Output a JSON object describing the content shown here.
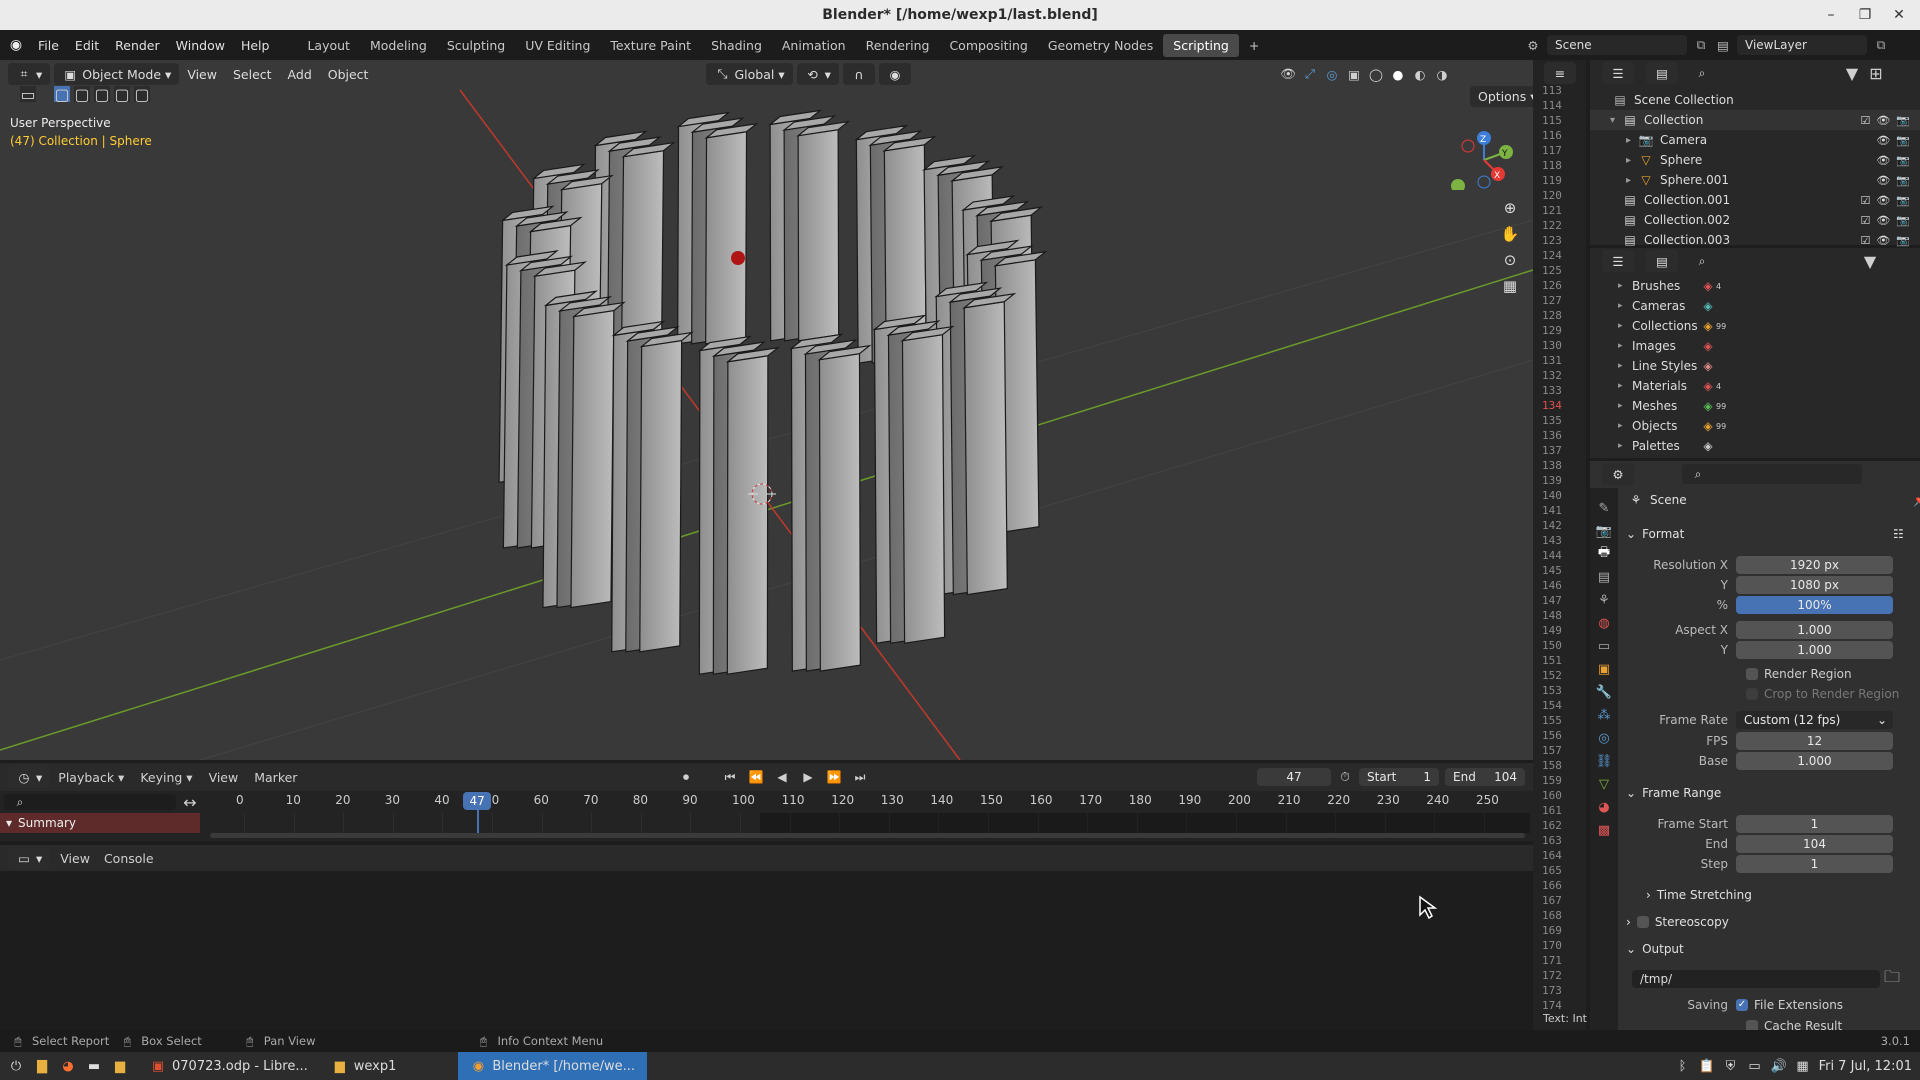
{
  "window": {
    "title": "Blender* [/home/wexp1/last.blend]"
  },
  "menu": [
    "File",
    "Edit",
    "Render",
    "Window",
    "Help"
  ],
  "workspaces": [
    "Layout",
    "Modeling",
    "Sculpting",
    "UV Editing",
    "Texture Paint",
    "Shading",
    "Animation",
    "Rendering",
    "Compositing",
    "Geometry Nodes",
    "Scripting"
  ],
  "active_workspace": "Scripting",
  "scene_field": "Scene",
  "viewlayer_field": "ViewLayer",
  "viewport": {
    "mode": "Object Mode",
    "menus": [
      "View",
      "Select",
      "Add",
      "Object"
    ],
    "transform_orientation": "Global",
    "options_label": "Options",
    "perspective_label": "User Perspective",
    "context_label": "(47) Collection | Sphere"
  },
  "text_editor": {
    "line_numbers": [
      "113",
      "114",
      "115",
      "116",
      "117",
      "118",
      "119",
      "120",
      "121",
      "122",
      "123",
      "124",
      "125",
      "126",
      "127",
      "128",
      "129",
      "130",
      "131",
      "132",
      "133",
      "134",
      "135",
      "136",
      "137",
      "138",
      "139",
      "140",
      "141",
      "142",
      "143",
      "144",
      "145",
      "146",
      "147",
      "148",
      "149",
      "150",
      "151",
      "152",
      "153",
      "154",
      "155",
      "156",
      "157",
      "158",
      "159",
      "160",
      "161",
      "162",
      "163",
      "164",
      "165",
      "166",
      "167",
      "168",
      "169",
      "170",
      "171",
      "172",
      "173",
      "174"
    ],
    "current_line": "134",
    "footer": "Text: Int"
  },
  "outliner": {
    "items": [
      {
        "label": "Scene Collection"
      },
      {
        "label": "Collection"
      },
      {
        "label": "Camera"
      },
      {
        "label": "Sphere"
      },
      {
        "label": "Sphere.001"
      },
      {
        "label": "Collection.001"
      },
      {
        "label": "Collection.002"
      },
      {
        "label": "Collection.003"
      }
    ]
  },
  "blend_file": {
    "items": [
      {
        "label": "Brushes",
        "badge": "4"
      },
      {
        "label": "Cameras",
        "badge": ""
      },
      {
        "label": "Collections",
        "badge": "99"
      },
      {
        "label": "Images",
        "badge": ""
      },
      {
        "label": "Line Styles",
        "badge": ""
      },
      {
        "label": "Materials",
        "badge": "4"
      },
      {
        "label": "Meshes",
        "badge": "99"
      },
      {
        "label": "Objects",
        "badge": "99"
      },
      {
        "label": "Palettes",
        "badge": ""
      }
    ]
  },
  "properties": {
    "context": "Scene",
    "format_section": "Format",
    "resolution_x_label": "Resolution X",
    "resolution_x": "1920 px",
    "resolution_y_label": "Y",
    "resolution_y": "1080 px",
    "resolution_pct_label": "%",
    "resolution_pct": "100%",
    "aspect_x_label": "Aspect X",
    "aspect_x": "1.000",
    "aspect_y_label": "Y",
    "aspect_y": "1.000",
    "render_region": "Render Region",
    "crop_region": "Crop to Render Region",
    "frame_rate_label": "Frame Rate",
    "frame_rate": "Custom (12 fps)",
    "fps_label": "FPS",
    "fps": "12",
    "base_label": "Base",
    "base": "1.000",
    "frame_range_section": "Frame Range",
    "frame_start_label": "Frame Start",
    "frame_start": "1",
    "end_label": "End",
    "end": "104",
    "step_label": "Step",
    "step": "1",
    "time_stretching": "Time Stretching",
    "stereoscopy": "Stereoscopy",
    "output_section": "Output",
    "output_path": "/tmp/",
    "saving_label": "Saving",
    "file_extensions": "File Extensions",
    "cache_result": "Cache Result"
  },
  "timeline": {
    "menus": [
      "Playback",
      "Keying",
      "View",
      "Marker"
    ],
    "current_frame": "47",
    "start_label": "Start",
    "start": "1",
    "end_label": "End",
    "end": "104",
    "ticks": [
      "0",
      "10",
      "20",
      "30",
      "40",
      "50",
      "60",
      "70",
      "80",
      "90",
      "100",
      "110",
      "120",
      "130",
      "140",
      "150",
      "160",
      "170",
      "180",
      "190",
      "200",
      "210",
      "220",
      "230",
      "240",
      "250"
    ],
    "playhead": "47",
    "summary": "Summary"
  },
  "console": {
    "menus": [
      "View",
      "Console"
    ]
  },
  "statusbar": {
    "items": [
      "Select Report",
      "Box Select",
      "Pan View",
      "Info Context Menu"
    ],
    "version": "3.0.1"
  },
  "taskbar": {
    "tasks": [
      "070723.odp - Libre...",
      "wexp1",
      "Blender* [/home/we..."
    ],
    "clock": "Fri 7 Jul, 12:01"
  },
  "colors": {
    "accent": "#4772b3",
    "active_workspace": "#4a4a4a",
    "x_axis": "#c0392b",
    "y_axis": "#6b9a2a",
    "current_line": "#e05050"
  }
}
